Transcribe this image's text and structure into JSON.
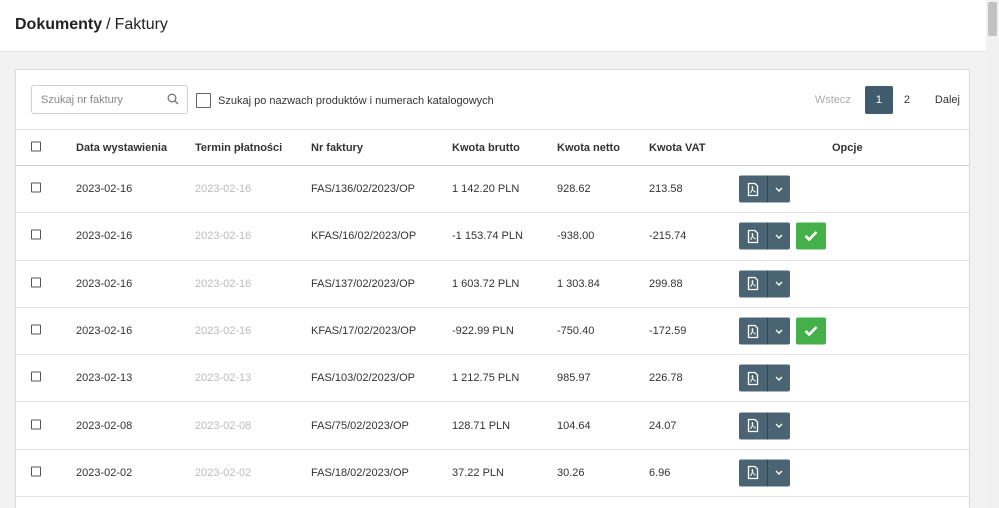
{
  "breadcrumb": {
    "root": "Dokumenty",
    "separator": "/",
    "current": "Faktury"
  },
  "search": {
    "placeholder": "Szukaj nr faktury",
    "value": ""
  },
  "product_search": {
    "label": "Szukaj po nazwach produktów i numerach katalogowych",
    "checked": false
  },
  "pagination": {
    "prev": "Wstecz",
    "pages": [
      "1",
      "2"
    ],
    "active": "1",
    "next": "Dalej"
  },
  "table": {
    "headers": {
      "date": "Data wystawienia",
      "due": "Termin płatności",
      "nr": "Nr faktury",
      "gross": "Kwota brutto",
      "net": "Kwota netto",
      "vat": "Kwota VAT",
      "options": "Opcje"
    },
    "rows": [
      {
        "date": "2023-02-16",
        "due": "2023-02-16",
        "nr": "FAS/136/02/2023/OP",
        "gross": "1 142.20 PLN",
        "net": "928.62",
        "vat": "213.58",
        "confirmed": false
      },
      {
        "date": "2023-02-16",
        "due": "2023-02-16",
        "nr": "KFAS/16/02/2023/OP",
        "gross": "-1 153.74 PLN",
        "net": "-938.00",
        "vat": "-215.74",
        "confirmed": true
      },
      {
        "date": "2023-02-16",
        "due": "2023-02-16",
        "nr": "FAS/137/02/2023/OP",
        "gross": "1 603.72 PLN",
        "net": "1 303.84",
        "vat": "299.88",
        "confirmed": false
      },
      {
        "date": "2023-02-16",
        "due": "2023-02-16",
        "nr": "KFAS/17/02/2023/OP",
        "gross": "-922.99 PLN",
        "net": "-750.40",
        "vat": "-172.59",
        "confirmed": true
      },
      {
        "date": "2023-02-13",
        "due": "2023-02-13",
        "nr": "FAS/103/02/2023/OP",
        "gross": "1 212.75 PLN",
        "net": "985.97",
        "vat": "226.78",
        "confirmed": false
      },
      {
        "date": "2023-02-08",
        "due": "2023-02-08",
        "nr": "FAS/75/02/2023/OP",
        "gross": "128.71 PLN",
        "net": "104.64",
        "vat": "24.07",
        "confirmed": false
      },
      {
        "date": "2023-02-02",
        "due": "2023-02-02",
        "nr": "FAS/18/02/2023/OP",
        "gross": "37.22 PLN",
        "net": "30.26",
        "vat": "6.96",
        "confirmed": false
      }
    ]
  },
  "icons": {
    "pdf": "pdf-file-icon",
    "dropdown": "chevron-down-icon",
    "confirm": "checkmark-icon",
    "search": "search-icon"
  },
  "colors": {
    "primary_button": "#4a6474",
    "confirm_button": "#43b049",
    "active_page": "#3f5b6d"
  }
}
